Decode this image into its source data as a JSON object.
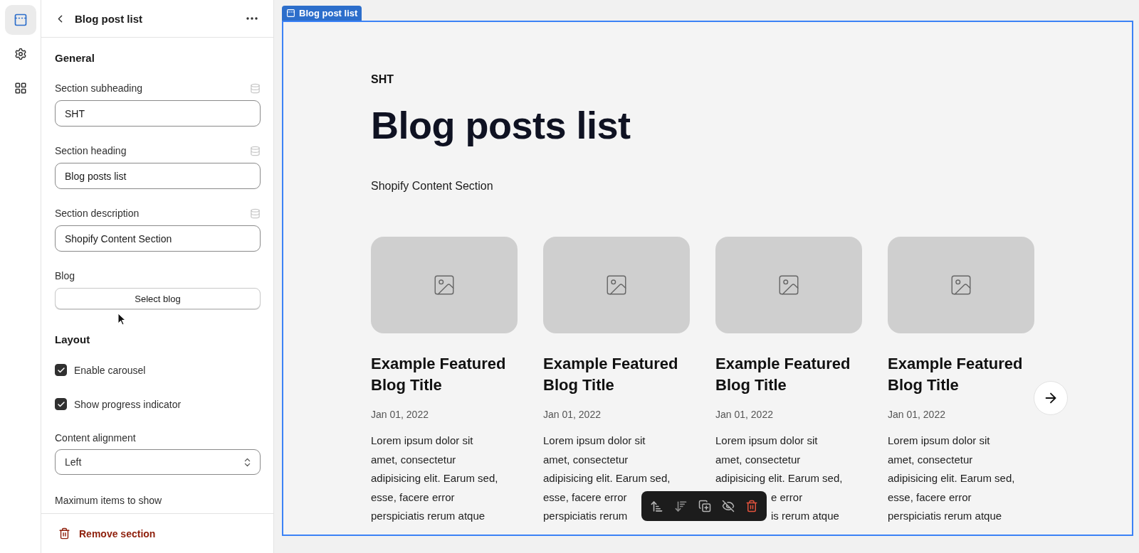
{
  "rail": [
    {
      "kind": "sections",
      "selected": true
    },
    {
      "kind": "settings",
      "selected": false
    },
    {
      "kind": "apps",
      "selected": false
    }
  ],
  "panel": {
    "title": "Blog post list",
    "group_heading": "General",
    "fields": [
      {
        "label": "Section subheading",
        "value": "SHT"
      },
      {
        "label": "Section heading",
        "value": "Blog posts list"
      },
      {
        "label": "Section description",
        "value": "Shopify Content Section"
      }
    ],
    "blog": {
      "label": "Blog",
      "button": "Select blog"
    },
    "layout_heading": "Layout",
    "checkboxes": [
      {
        "label": "Enable carousel",
        "checked": true
      },
      {
        "label": "Show progress indicator",
        "checked": true
      }
    ],
    "alignment": {
      "label": "Content alignment",
      "value": "Left"
    },
    "max_items_label": "Maximum items to show",
    "remove": "Remove section"
  },
  "preview": {
    "tag": "Blog post list",
    "subheading": "SHT",
    "heading": "Blog posts list",
    "description": "Shopify Content Section",
    "cards": [
      {
        "title": "Example Featured Blog Title",
        "date": "Jan 01, 2022",
        "excerpt": [
          {
            "text": "Lorem ipsum dolor sit",
            "kind": "line"
          },
          {
            "text": "amet, consectetur",
            "kind": "line"
          },
          {
            "text": "adipisicing elit. Earum sed,",
            "kind": "line"
          },
          {
            "text": "esse, facere error",
            "kind": "line"
          },
          {
            "text": "perspiciatis rerum atque",
            "kind": "line"
          }
        ]
      },
      {
        "title": "Example Featured Blog Title",
        "date": "Jan 01, 2022",
        "excerpt": [
          {
            "text": "Lorem ipsum dolor sit",
            "kind": "line"
          },
          {
            "text": "amet, consectetur",
            "kind": "line"
          },
          {
            "text": "adipisicing elit. Earum sed,",
            "kind": "line"
          },
          {
            "text": "esse, facere error",
            "kind": "line"
          },
          {
            "text": "perspiciatis rerum",
            "kind": "line"
          }
        ]
      },
      {
        "title": "Example Featured Blog Title",
        "date": "Jan 01, 2022",
        "excerpt": [
          {
            "text": "Lorem ipsum dolor sit",
            "kind": "line"
          },
          {
            "text": "amet, consectetur",
            "kind": "line"
          },
          {
            "text": "adipisicing elit. Earum sed,",
            "kind": "line"
          },
          {
            "text": "e error",
            "kind": "tail"
          },
          {
            "text": "is rerum atque",
            "kind": "tail"
          }
        ]
      },
      {
        "title": "Example Featured Blog Title",
        "date": "Jan 01, 2022",
        "excerpt": [
          {
            "text": "Lorem ipsum dolor sit",
            "kind": "line"
          },
          {
            "text": "amet, consectetur",
            "kind": "line"
          },
          {
            "text": "adipisicing elit. Earum sed,",
            "kind": "line"
          },
          {
            "text": "esse, facere error",
            "kind": "line"
          },
          {
            "text": "perspiciatis rerum atque",
            "kind": "line"
          }
        ]
      }
    ],
    "toolbar": [
      {
        "kind": "move-up"
      },
      {
        "kind": "move-down"
      },
      {
        "kind": "duplicate"
      },
      {
        "kind": "hide"
      },
      {
        "kind": "delete"
      }
    ]
  }
}
